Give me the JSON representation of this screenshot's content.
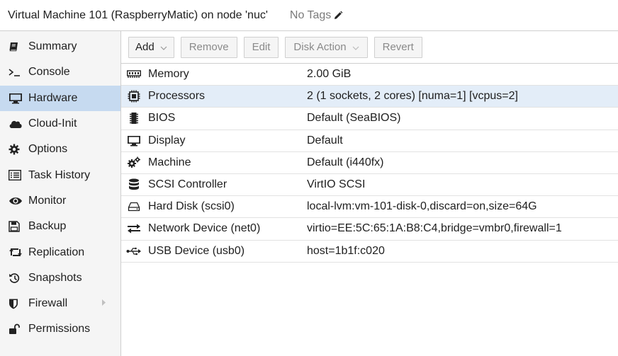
{
  "header": {
    "title": "Virtual Machine 101 (RaspberryMatic) on node 'nuc'",
    "tags": "No Tags",
    "tags_icon": "pencil-icon"
  },
  "sidebar": {
    "items": [
      {
        "label": "Summary",
        "icon": "book-icon",
        "active": false
      },
      {
        "label": "Console",
        "icon": "terminal-icon",
        "active": false
      },
      {
        "label": "Hardware",
        "icon": "desktop-icon",
        "active": true
      },
      {
        "label": "Cloud-Init",
        "icon": "cloud-icon",
        "active": false
      },
      {
        "label": "Options",
        "icon": "gear-icon",
        "active": false
      },
      {
        "label": "Task History",
        "icon": "list-icon",
        "active": false
      },
      {
        "label": "Monitor",
        "icon": "eye-icon",
        "active": false
      },
      {
        "label": "Backup",
        "icon": "floppy-icon",
        "active": false
      },
      {
        "label": "Replication",
        "icon": "retweet-icon",
        "active": false
      },
      {
        "label": "Snapshots",
        "icon": "history-icon",
        "active": false
      },
      {
        "label": "Firewall",
        "icon": "shield-icon",
        "active": false
      },
      {
        "label": "Permissions",
        "icon": "unlock-icon",
        "active": false
      }
    ]
  },
  "toolbar": {
    "add": "Add",
    "remove": "Remove",
    "edit": "Edit",
    "disk_action": "Disk Action",
    "revert": "Revert"
  },
  "hardware": {
    "rows": [
      {
        "label": "Memory",
        "value": "2.00 GiB",
        "icon": "memory-icon"
      },
      {
        "label": "Processors",
        "value": "2 (1 sockets, 2 cores) [numa=1] [vcpus=2]",
        "icon": "cpu-icon"
      },
      {
        "label": "BIOS",
        "value": "Default (SeaBIOS)",
        "icon": "microchip-icon"
      },
      {
        "label": "Display",
        "value": "Default",
        "icon": "monitor-icon"
      },
      {
        "label": "Machine",
        "value": "Default (i440fx)",
        "icon": "cogs-icon"
      },
      {
        "label": "SCSI Controller",
        "value": "VirtIO SCSI",
        "icon": "database-icon"
      },
      {
        "label": "Hard Disk (scsi0)",
        "value": "local-lvm:vm-101-disk-0,discard=on,size=64G",
        "icon": "hdd-icon"
      },
      {
        "label": "Network Device (net0)",
        "value": "virtio=EE:5C:65:1A:B8:C4,bridge=vmbr0,firewall=1",
        "icon": "exchange-icon"
      },
      {
        "label": "USB Device (usb0)",
        "value": "host=1b1f:c020",
        "icon": "usb-icon"
      }
    ]
  },
  "colors": {
    "active_nav": "#c6daf0",
    "selected_row": "#e3edf8"
  }
}
